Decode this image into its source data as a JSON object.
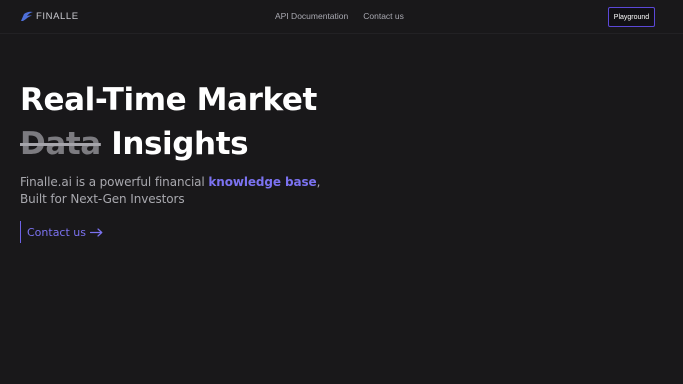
{
  "navbar": {
    "brand": "FINALLE",
    "links": [
      "API Documentation",
      "Contact us"
    ],
    "cta_label": "Playground"
  },
  "hero": {
    "title_line1": "Real-Time Market",
    "title_struck": "Data",
    "title_line2_rest": " Insights",
    "desc_prefix": "Finalle.ai is a powerful financial ",
    "desc_highlight": "knowledge base",
    "desc_suffix": ",",
    "desc_line2": "Built for Next-Gen Investors",
    "cta_label": "Contact us"
  },
  "colors": {
    "background": "#19181a",
    "accent": "#7b72f0",
    "button_border": "#5b48d8"
  },
  "icons": {
    "brand": "finalle-logo-icon",
    "cta": "arrow-right-icon"
  }
}
